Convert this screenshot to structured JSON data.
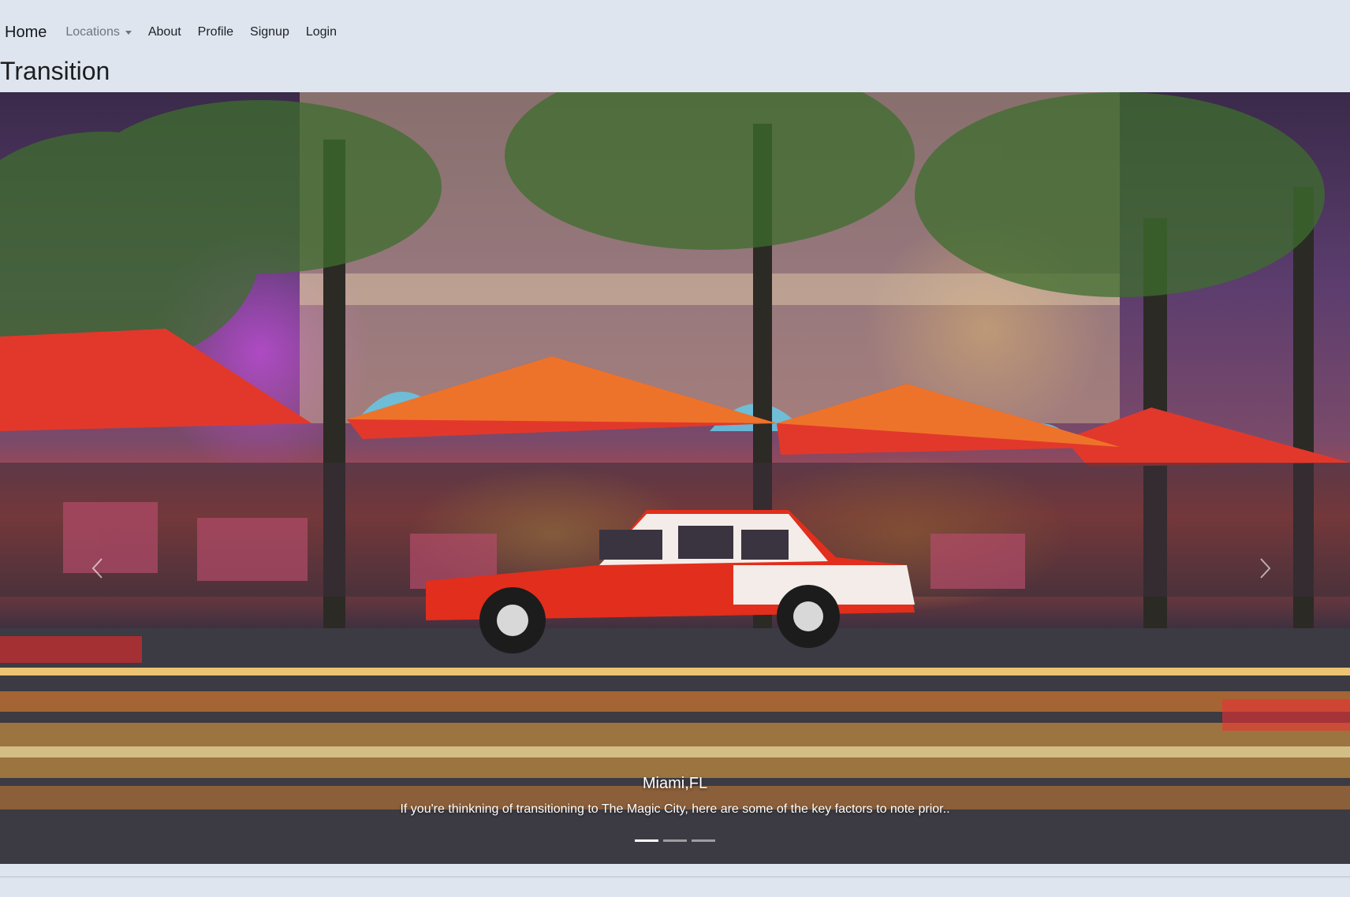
{
  "navbar": {
    "brand": "Home",
    "links": [
      {
        "label": "Locations",
        "dropdown": true
      },
      {
        "label": "About"
      },
      {
        "label": "Profile"
      },
      {
        "label": "Signup"
      },
      {
        "label": "Login"
      }
    ]
  },
  "page": {
    "title": "Transition"
  },
  "carousel": {
    "slides": [
      {
        "title": "Miami,FL",
        "text": "If you're thinkning of transitioning to The Magic City, here are some of the key factors to note prior..",
        "image": "miami-night-street-scene"
      }
    ],
    "indicators": [
      {
        "active": true
      },
      {
        "active": false
      },
      {
        "active": false
      }
    ],
    "controls": {
      "prev_icon": "chevron-left-icon",
      "next_icon": "chevron-right-icon"
    }
  },
  "colors": {
    "background": "#dfe5ee",
    "caption_text": "#ffffff",
    "nav_muted": "#6c757d"
  }
}
